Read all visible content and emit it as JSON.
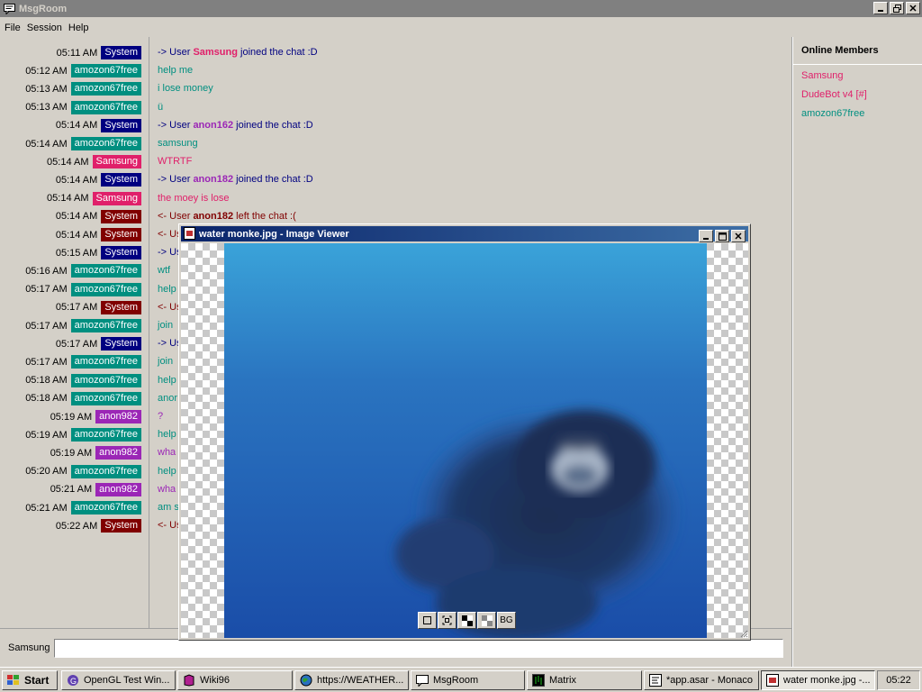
{
  "window": {
    "title": "MsgRoom"
  },
  "menu": [
    "File",
    "Session",
    "Help"
  ],
  "colors": {
    "System": "#000080",
    "System-red": "#800000",
    "amozon67free": "#008f80",
    "Samsung": "#e0206a",
    "anon982": "#9b26b6"
  },
  "messages": [
    {
      "time": "05:11 AM",
      "user": "System",
      "badge": "#000080",
      "color": "#000080",
      "pre": "-> User ",
      "name": "Samsung",
      "name_color": "#e0206a",
      "post": " joined the chat :D"
    },
    {
      "time": "05:12 AM",
      "user": "amozon67free",
      "badge": "#008f80",
      "color": "#008f80",
      "text": "help me"
    },
    {
      "time": "05:13 AM",
      "user": "amozon67free",
      "badge": "#008f80",
      "color": "#008f80",
      "text": "i lose money"
    },
    {
      "time": "05:13 AM",
      "user": "amozon67free",
      "badge": "#008f80",
      "color": "#008f80",
      "text": "ü"
    },
    {
      "time": "05:14 AM",
      "user": "System",
      "badge": "#000080",
      "color": "#000080",
      "pre": "-> User ",
      "name": "anon162",
      "name_color": "#9b26b6",
      "post": " joined the chat :D"
    },
    {
      "time": "05:14 AM",
      "user": "amozon67free",
      "badge": "#008f80",
      "color": "#008f80",
      "text": "samsung"
    },
    {
      "time": "05:14 AM",
      "user": "Samsung",
      "badge": "#e0206a",
      "color": "#e0206a",
      "text": "WTRTF"
    },
    {
      "time": "05:14 AM",
      "user": "System",
      "badge": "#000080",
      "color": "#000080",
      "pre": "-> User ",
      "name": "anon182",
      "name_color": "#9b26b6",
      "post": " joined the chat :D"
    },
    {
      "time": "05:14 AM",
      "user": "Samsung",
      "badge": "#e0206a",
      "color": "#e0206a",
      "text": "the moey is lose"
    },
    {
      "time": "05:14 AM",
      "user": "System",
      "badge": "#800000",
      "color": "#800000",
      "pre": "<- User ",
      "name": "anon182",
      "name_color": "#800000",
      "post": " left the chat :("
    },
    {
      "time": "05:14 AM",
      "user": "System",
      "badge": "#800000",
      "color": "#800000",
      "text": "<- Us"
    },
    {
      "time": "05:15 AM",
      "user": "System",
      "badge": "#000080",
      "color": "#000080",
      "text": "-> Us"
    },
    {
      "time": "05:16 AM",
      "user": "amozon67free",
      "badge": "#008f80",
      "color": "#008f80",
      "text": "wtf"
    },
    {
      "time": "05:17 AM",
      "user": "amozon67free",
      "badge": "#008f80",
      "color": "#008f80",
      "text": "help"
    },
    {
      "time": "05:17 AM",
      "user": "System",
      "badge": "#800000",
      "color": "#800000",
      "text": "<- Us"
    },
    {
      "time": "05:17 AM",
      "user": "amozon67free",
      "badge": "#008f80",
      "color": "#008f80",
      "text": "join"
    },
    {
      "time": "05:17 AM",
      "user": "System",
      "badge": "#000080",
      "color": "#000080",
      "text": "-> Us"
    },
    {
      "time": "05:17 AM",
      "user": "amozon67free",
      "badge": "#008f80",
      "color": "#008f80",
      "text": "join"
    },
    {
      "time": "05:18 AM",
      "user": "amozon67free",
      "badge": "#008f80",
      "color": "#008f80",
      "text": "help"
    },
    {
      "time": "05:18 AM",
      "user": "amozon67free",
      "badge": "#008f80",
      "color": "#008f80",
      "text": "anor"
    },
    {
      "time": "05:19 AM",
      "user": "anon982",
      "badge": "#9b26b6",
      "color": "#9b26b6",
      "text": "?"
    },
    {
      "time": "05:19 AM",
      "user": "amozon67free",
      "badge": "#008f80",
      "color": "#008f80",
      "text": "help"
    },
    {
      "time": "05:19 AM",
      "user": "anon982",
      "badge": "#9b26b6",
      "color": "#9b26b6",
      "text": "wha"
    },
    {
      "time": "05:20 AM",
      "user": "amozon67free",
      "badge": "#008f80",
      "color": "#008f80",
      "text": "help"
    },
    {
      "time": "05:21 AM",
      "user": "anon982",
      "badge": "#9b26b6",
      "color": "#9b26b6",
      "text": "wha"
    },
    {
      "time": "05:21 AM",
      "user": "amozon67free",
      "badge": "#008f80",
      "color": "#008f80",
      "text": "am s"
    },
    {
      "time": "05:22 AM",
      "user": "System",
      "badge": "#800000",
      "color": "#800000",
      "text": "<- Us"
    }
  ],
  "members": {
    "title": "Online Members",
    "list": [
      {
        "name": "Samsung",
        "color": "#e0206a"
      },
      {
        "name": "DudeBot v4 [#]",
        "color": "#e0206a"
      },
      {
        "name": "amozon67free",
        "color": "#008f80"
      }
    ]
  },
  "input": {
    "label": "Samsung",
    "value": "",
    "placeholder": ""
  },
  "viewer": {
    "title": "water monke.jpg - Image Viewer",
    "toolbar": [
      "fit-icon",
      "actual-size-icon",
      "checker-dark-icon",
      "checker-light-icon",
      "BG"
    ]
  },
  "taskbar": {
    "start": "Start",
    "tasks": [
      {
        "label": "OpenGL Test Win...",
        "icon": "opengl-icon"
      },
      {
        "label": "Wiki96",
        "icon": "book-icon"
      },
      {
        "label": "https://WEATHER...",
        "icon": "globe-icon"
      },
      {
        "label": "MsgRoom",
        "icon": "chat-icon"
      },
      {
        "label": "Matrix",
        "icon": "matrix-icon"
      },
      {
        "label": "*app.asar - Monaco",
        "icon": "editor-icon"
      },
      {
        "label": "water monke.jpg -...",
        "icon": "image-icon",
        "active": true
      }
    ],
    "clock": "05:22"
  }
}
